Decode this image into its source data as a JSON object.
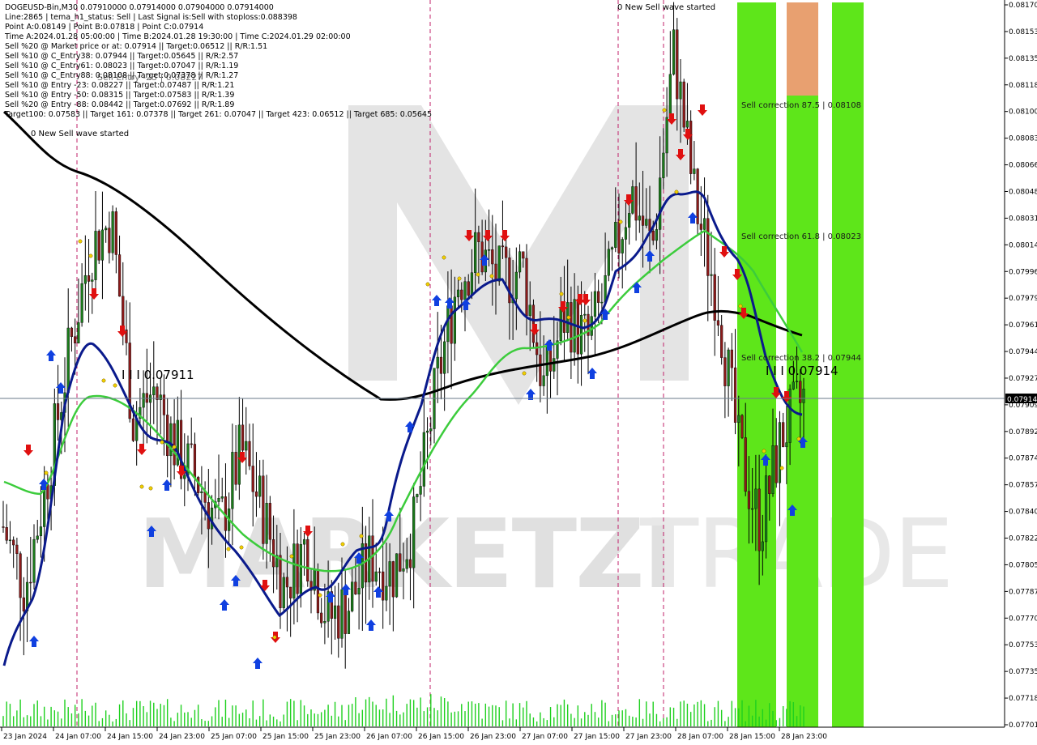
{
  "info": {
    "lines": [
      "DOGEUSD-Bin,M30  0.07910000 0.07914000 0.07904000 0.07914000",
      "Line:2865  | tema_h1_status: Sell  | Last Signal is:Sell with stoploss:0.088398",
      "Point A:0.08149 | Point B:0.07818 | Point C:0.07914",
      "Time A:2024.01.28 05:00:00 | Time B:2024.01.28 19:30:00 | Time C:2024.01.29 02:00:00",
      "Sell %20 @ Market price or at: 0.07914 || Target:0.06512 || R/R:1.51",
      "Sell %10 @ C_Entry38: 0.07944 || Target:0.05645 || R/R:2.57",
      "Sell %10 @ C_Entry61: 0.08023 || Target:0.07047 || R/R:1.19",
      "Sell %10 @ C_Entry88: 0.08108 || Target:0.07378 || R/R:1.27",
      "Sell %10 @ Entry -23: 0.08227 || Target:0.07487 || R/R:1.21",
      "Sell %10 @ Entry -50: 0.08315 || Target:0.07583 || R/R:1.39",
      "Sell %20 @ Entry -88: 0.08442 || Target:0.07692 || R/R:1.89",
      "Target100: 0.07583 || Target 161: 0.07378 || Target 261: 0.07047 || Target 423: 0.06512 || Target 685: 0.05645"
    ],
    "overlap_text": "Sell Entry -23 | 0.08227"
  },
  "annotations": {
    "wave_left": "0 New Sell wave started",
    "wave_top": "0 New Sell wave started",
    "level_left": "I I I 0.07911",
    "level_right": "I I I 0.07914",
    "corr_875": "Sell correction 87.5 | 0.08108",
    "corr_618": "Sell correction 61.8 | 0.08023",
    "corr_382": "Sell correction 38.2 | 0.07944"
  },
  "watermark": {
    "left": "MARKETZI",
    "right": "TRADE"
  },
  "price_axis": {
    "ticks": [
      "0.08170",
      "0.08153",
      "0.08135",
      "0.08118",
      "0.08100",
      "0.08083",
      "0.08066",
      "0.08048",
      "0.08031",
      "0.08014",
      "0.07996",
      "0.07979",
      "0.07961",
      "0.07944",
      "0.07927",
      "0.07909",
      "0.07892",
      "0.07874",
      "0.07857",
      "0.07840",
      "0.07822",
      "0.07805",
      "0.07787",
      "0.07770",
      "0.07753",
      "0.07735",
      "0.07718",
      "0.07701"
    ],
    "current_price": "0.07914"
  },
  "time_axis": {
    "ticks": [
      "23 Jan 2024",
      "24 Jan 07:00",
      "24 Jan 15:00",
      "24 Jan 23:00",
      "25 Jan 07:00",
      "25 Jan 15:00",
      "25 Jan 23:00",
      "26 Jan 07:00",
      "26 Jan 15:00",
      "26 Jan 23:00",
      "27 Jan 07:00",
      "27 Jan 15:00",
      "27 Jan 23:00",
      "28 Jan 07:00",
      "28 Jan 15:00",
      "28 Jan 23:00"
    ]
  },
  "colors": {
    "background": "#ffffff",
    "bull_candle": "#1a7a1a",
    "bear_candle": "#8b1a1a",
    "tema_blue": "#0a1a8c",
    "ma_green": "#3ccc3c",
    "ma_black": "#000000",
    "zone_green": "#5ee61a",
    "zone_orange": "#e8a070",
    "arrow_red": "#e01010",
    "arrow_blue": "#1040e0",
    "dash_magenta": "#c0206a",
    "volume": "#1fd01f"
  },
  "chart_data": {
    "type": "candlestick",
    "symbol": "DOGEUSD-Bin",
    "timeframe": "M30",
    "ylim": [
      0.07701,
      0.0817
    ],
    "x_range": [
      "23 Jan 2024",
      "29 Jan 02:00"
    ],
    "ohlc_last": {
      "open": 0.0791,
      "high": 0.07914,
      "low": 0.07904,
      "close": 0.07914
    },
    "key_points": {
      "A": 0.08149,
      "B": 0.07818,
      "C": 0.07914
    },
    "levels": [
      {
        "name": "Sell correction 87.5",
        "price": 0.08108
      },
      {
        "name": "Sell correction 61.8",
        "price": 0.08023
      },
      {
        "name": "Sell correction 38.2",
        "price": 0.07944
      },
      {
        "name": "current",
        "price": 0.07914
      }
    ],
    "path_close": [
      [
        "23 Jan 00:00",
        0.0783
      ],
      [
        "23 Jan 04:00",
        0.0779
      ],
      [
        "23 Jan 08:00",
        0.0786
      ],
      [
        "23 Jan 12:00",
        0.0794
      ],
      [
        "23 Jan 16:00",
        0.0801
      ],
      [
        "23 Jan 20:00",
        0.0803
      ],
      [
        "24 Jan 00:00",
        0.079
      ],
      [
        "24 Jan 04:00",
        0.0792
      ],
      [
        "24 Jan 08:00",
        0.0788
      ],
      [
        "24 Jan 12:00",
        0.0786
      ],
      [
        "24 Jan 16:00",
        0.0783
      ],
      [
        "24 Jan 20:00",
        0.0788
      ],
      [
        "25 Jan 00:00",
        0.0784
      ],
      [
        "25 Jan 04:00",
        0.0779
      ],
      [
        "25 Jan 08:00",
        0.0782
      ],
      [
        "25 Jan 12:00",
        0.0777
      ],
      [
        "25 Jan 16:00",
        0.0778
      ],
      [
        "25 Jan 20:00",
        0.0781
      ],
      [
        "26 Jan 00:00",
        0.078
      ],
      [
        "26 Jan 04:00",
        0.0783
      ],
      [
        "26 Jan 08:00",
        0.0792
      ],
      [
        "26 Jan 12:00",
        0.0799
      ],
      [
        "26 Jan 16:00",
        0.0801
      ],
      [
        "26 Jan 20:00",
        0.0799
      ],
      [
        "27 Jan 00:00",
        0.08
      ],
      [
        "27 Jan 04:00",
        0.0792
      ],
      [
        "27 Jan 08:00",
        0.0797
      ],
      [
        "27 Jan 12:00",
        0.0795
      ],
      [
        "27 Jan 16:00",
        0.0799
      ],
      [
        "27 Jan 20:00",
        0.0805
      ],
      [
        "28 Jan 00:00",
        0.0801
      ],
      [
        "28 Jan 04:00",
        0.0814
      ],
      [
        "28 Jan 08:00",
        0.0804
      ],
      [
        "28 Jan 12:00",
        0.0798
      ],
      [
        "28 Jan 16:00",
        0.0788
      ],
      [
        "28 Jan 20:00",
        0.0783
      ],
      [
        "29 Jan 00:00",
        0.0789
      ],
      [
        "29 Jan 02:00",
        0.07914
      ]
    ]
  }
}
